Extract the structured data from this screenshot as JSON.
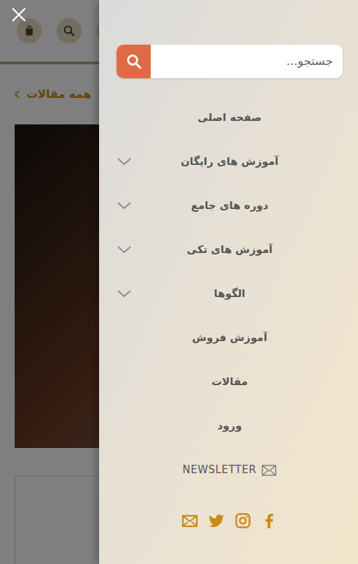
{
  "breadcrumb": {
    "label": "همه مقالات"
  },
  "search": {
    "placeholder": "جستجو..."
  },
  "menu": [
    {
      "label": "صفحه اصلی",
      "kind": "link"
    },
    {
      "label": "آموزش های رایگان",
      "kind": "dropdown"
    },
    {
      "label": "دوره های جامع",
      "kind": "dropdown"
    },
    {
      "label": "آموزش های تکی",
      "kind": "dropdown"
    },
    {
      "label": "الگوها",
      "kind": "dropdown"
    },
    {
      "label": "آموزش فروش",
      "kind": "link"
    },
    {
      "label": "مقالات",
      "kind": "link"
    },
    {
      "label": "ورود",
      "kind": "link"
    }
  ],
  "newsletter": {
    "label": "NEWSLETTER"
  },
  "social": [
    {
      "kind": "email"
    },
    {
      "kind": "twitter"
    },
    {
      "kind": "instagram"
    },
    {
      "kind": "facebook"
    }
  ]
}
